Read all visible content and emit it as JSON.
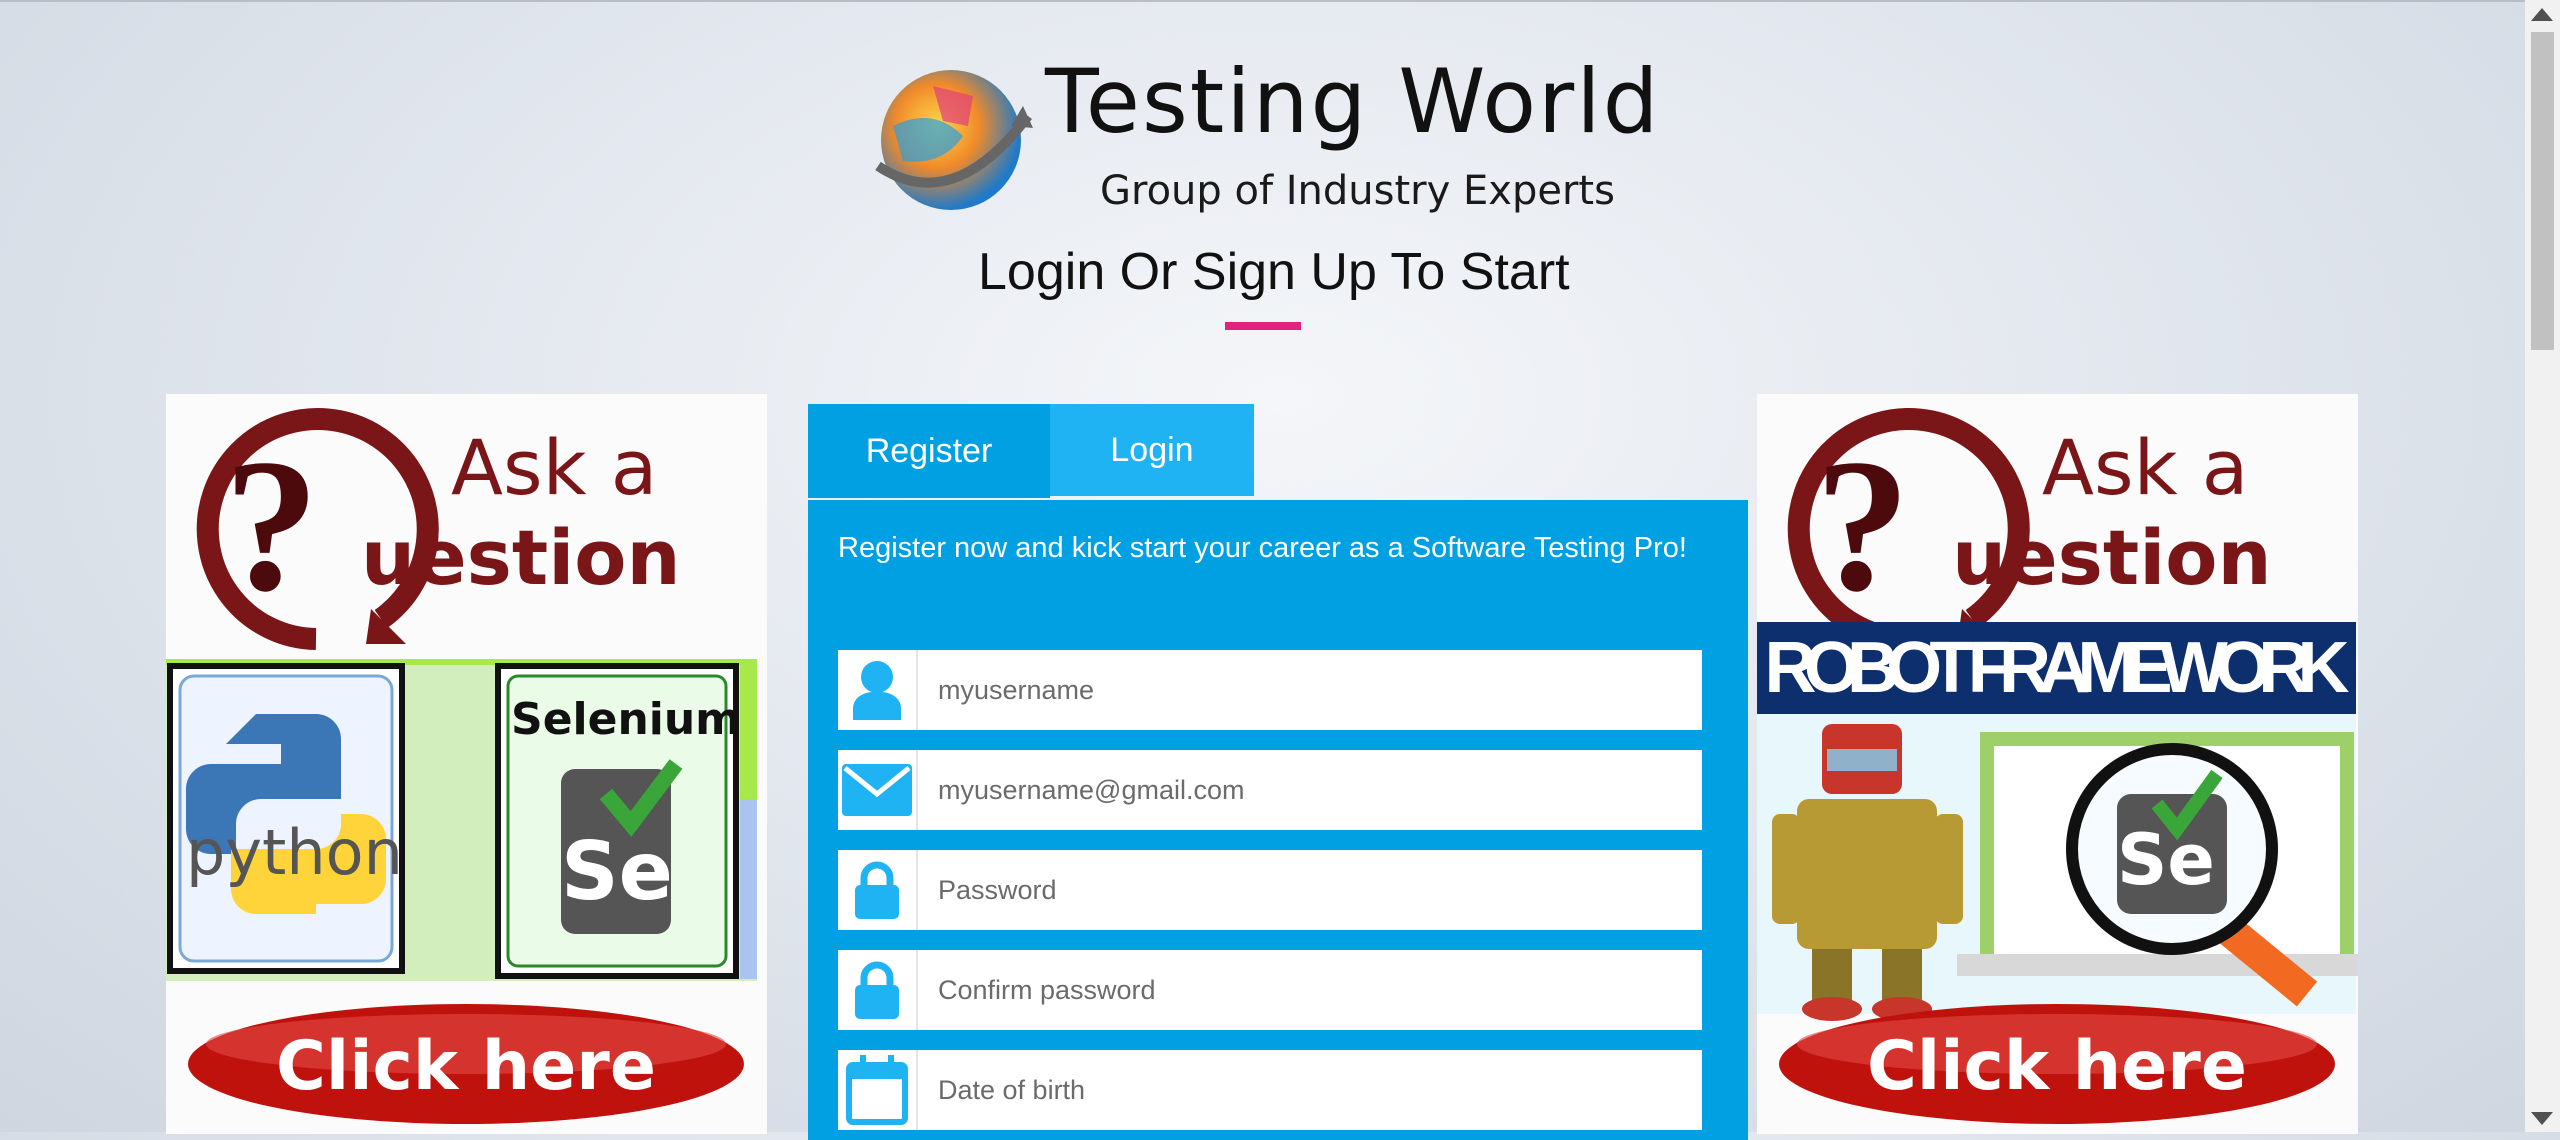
{
  "brand": {
    "title": "Testing World",
    "subtitle": "Group of Industry Experts"
  },
  "heading": "Login Or Sign Up To Start",
  "tabs": [
    {
      "label": "Register"
    },
    {
      "label": "Login"
    }
  ],
  "form": {
    "intro": "Register now and kick start your career as a Software Testing Pro!",
    "fields": [
      {
        "placeholder": "myusername",
        "icon": "user-icon"
      },
      {
        "placeholder": "myusername@gmail.com",
        "icon": "envelope-icon"
      },
      {
        "placeholder": "Password",
        "icon": "lock-icon"
      },
      {
        "placeholder": "Confirm password",
        "icon": "lock-icon"
      },
      {
        "placeholder": "Date of birth",
        "icon": "calendar-icon"
      }
    ]
  },
  "ads": {
    "left": {
      "line1": "Ask a",
      "line2": "uestion",
      "python": "python",
      "selenium": "Selenium",
      "se": "Se",
      "cta": "Click here"
    },
    "right": {
      "line1": "Ask a",
      "line2": "uestion",
      "banner": "ROBOT FRAMEWORK",
      "se": "Se",
      "cta": "Click here"
    }
  },
  "colors": {
    "accent": "#00a0e3",
    "tab_active": "#1fb3f3",
    "underline": "#e3227b",
    "cta_red": "#c0120d",
    "question_maroon": "#7a1518"
  }
}
